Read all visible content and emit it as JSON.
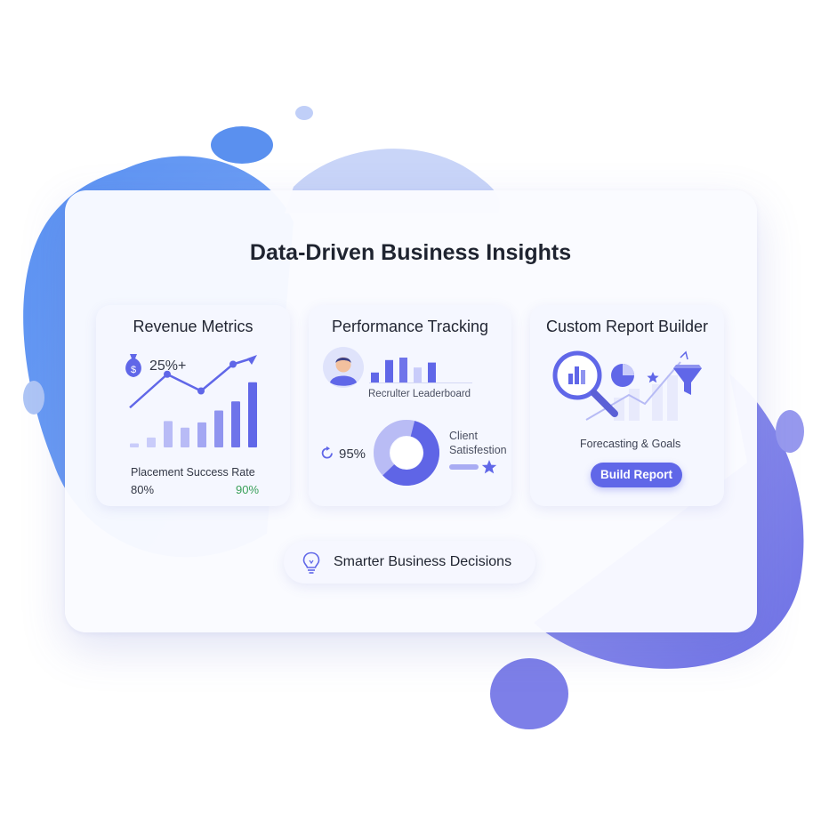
{
  "title": "Data-Driven Business Insights",
  "colors": {
    "accent": "#6067e8",
    "light_accent": "#c9ccfa",
    "blob_blue": "#5b8ff0",
    "blob_violet": "#7c7ee8",
    "positive": "#3aa05a"
  },
  "cards": {
    "revenue": {
      "title": "Revenue Metrics",
      "icon": "money-bag-icon",
      "growth": "25%+",
      "bars": [
        0.06,
        0.15,
        0.4,
        0.3,
        0.38,
        0.56,
        0.7,
        0.99
      ],
      "line_points": [
        0.25,
        0.75,
        0.5,
        0.9,
        1.0
      ],
      "caption": "Placement Success Rate",
      "left_value": "80%",
      "right_value": "90%"
    },
    "performance": {
      "title": "Performance Tracking",
      "avatar": "recruiter-avatar-icon",
      "leaderboard_bars": [
        0.4,
        0.9,
        1.0,
        0.6,
        0.8
      ],
      "leaderboard_label": "Recrulter Leaderboard",
      "refresh_icon": "refresh-icon",
      "percent": "95%",
      "satisfaction": 0.95,
      "satisfaction_label_line1": "Client",
      "satisfaction_label_line2": "Satisfestion",
      "star_icon": "star-icon"
    },
    "report": {
      "title": "Custom Report Builder",
      "icons": [
        "magnifier-chart-icon",
        "pie-chart-icon",
        "star-icon",
        "funnel-icon"
      ],
      "caption": "Forecasting & Goals",
      "button_label": "Build Report"
    }
  },
  "footer": {
    "icon": "lightbulb-icon",
    "label": "Smarter Business Decisions"
  }
}
